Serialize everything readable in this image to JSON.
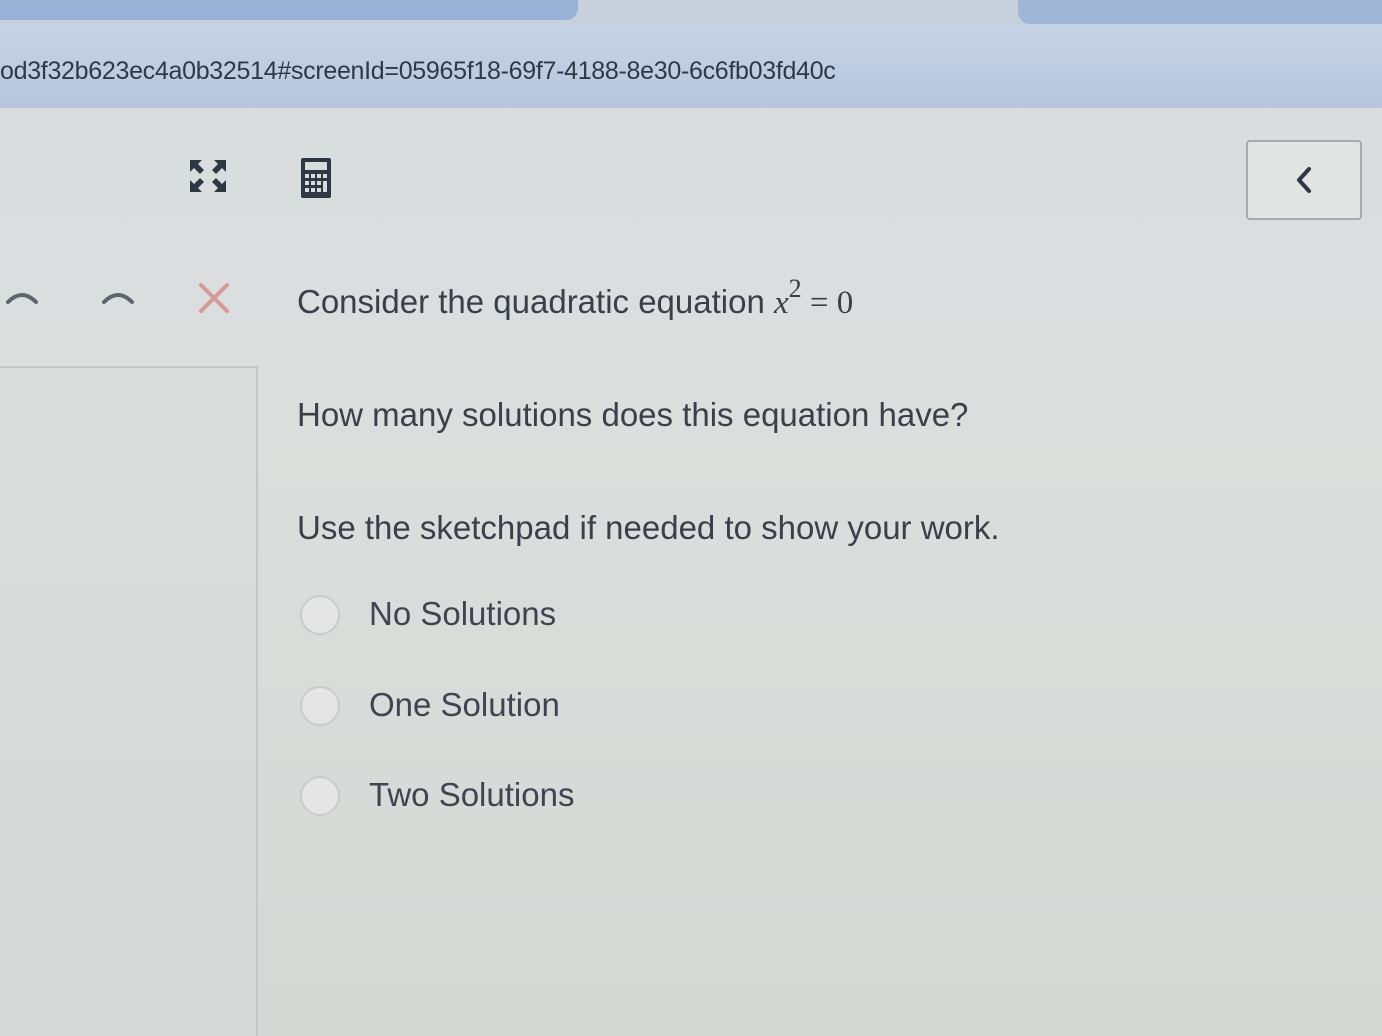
{
  "browser": {
    "url": "od3f32b623ec4a0b32514#screenId=05965f18-69f7-4188-8e30-6c6fb03fd40c"
  },
  "toolbar": {
    "icons": [
      "fullscreen-icon",
      "calculator-icon"
    ],
    "back_label": "<"
  },
  "nav": {
    "close_label": "X"
  },
  "question": {
    "prompt": "Consider the quadratic equation ",
    "equation_base": "x",
    "equation_exponent": "2",
    "equation_rest": " = 0",
    "ask": "How many solutions does this equation have?",
    "hint": "Use the sketchpad if needed to show your work.",
    "choices": [
      {
        "label": "No Solutions"
      },
      {
        "label": "One Solution"
      },
      {
        "label": "Two Solutions"
      }
    ]
  },
  "colors": {
    "page_bg": "#dcdedd",
    "url_bar": "#bccade",
    "text": "#3a3f48",
    "close_x": "#d59a96"
  }
}
